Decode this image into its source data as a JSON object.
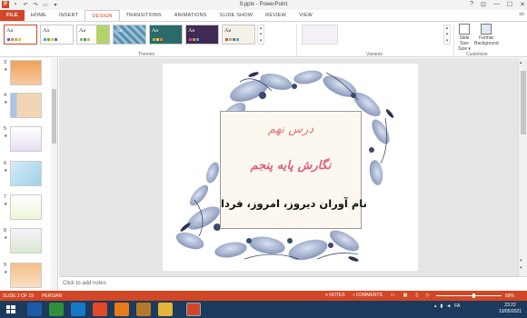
{
  "window": {
    "title": "9.pptx - PowerPoint",
    "controls": [
      "?",
      "⊡",
      "—",
      "☐",
      "✕"
    ]
  },
  "tabs": [
    "FILE",
    "HOME",
    "INSERT",
    "DESIGN",
    "TRANSITIONS",
    "ANIMATIONS",
    "SLIDE SHOW",
    "REVIEW",
    "VIEW"
  ],
  "user": "sh",
  "ribbon": {
    "themes_label": "Themes",
    "variants_label": "Variants",
    "customize_label": "Customize",
    "slide_size_label": "Slide Size",
    "slide_size_label2": "Size ▾",
    "format_bg_label": "Format",
    "format_bg_label2": "Background",
    "theme_aa": "Aa"
  },
  "thumbnails": [
    "3",
    "4",
    "5",
    "6",
    "7",
    "8",
    "9"
  ],
  "slide": {
    "line1": "درس نهم",
    "line2": "نگارش پایه پنجم",
    "line3": "نام آوران دیروز، امروز، فردا"
  },
  "notes_placeholder": "Click to add notes",
  "status": {
    "slide_of": "SLIDE 2 OF 19",
    "language": "PERSIAN",
    "notes": "≡ NOTES",
    "comments": "▪ COMMENTS",
    "zoom": "69%"
  },
  "taskbar": {
    "lang": "FA",
    "time": "23:22",
    "date": "13/05/2021"
  },
  "colors": {
    "accent": "#d24726",
    "taskbar": "#1c3a5c"
  }
}
